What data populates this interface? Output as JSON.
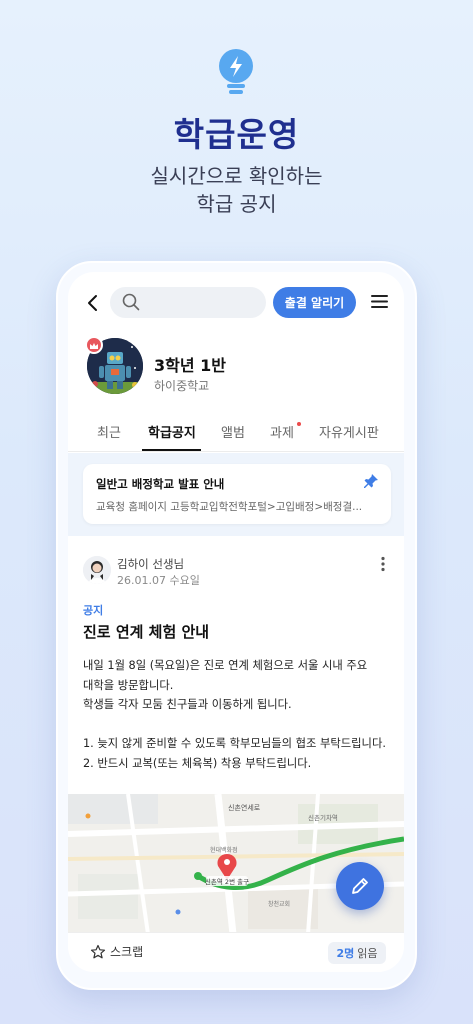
{
  "hero": {
    "title": "학급운영",
    "subtitle_line1": "실시간으로 확인하는",
    "subtitle_line2": "학급 공지"
  },
  "topbar": {
    "search_placeholder": "",
    "notice_button": "출결 알리기"
  },
  "class_header": {
    "class_name": "3학년 1반",
    "school_name": "하이중학교"
  },
  "tabs": [
    {
      "label": "최근",
      "active": false
    },
    {
      "label": "학급공지",
      "active": true
    },
    {
      "label": "앨범",
      "active": false
    },
    {
      "label": "과제",
      "active": false,
      "has_dot": true
    },
    {
      "label": "자유게시판",
      "active": false
    }
  ],
  "pinned": {
    "title": "일반고 배정학교 발표 안내",
    "description": "교육청 홈페이지 고등학교입학전학포털>고입배정>배정결..."
  },
  "post": {
    "author": "김하이 선생님",
    "date": "26.01.07 수요일",
    "category": "공지",
    "title": "진로 연계 체험 안내",
    "body_lines": [
      "내일 1월 8일 (목요일)은 진로 연계 체험으로 서울 시내 주요",
      "대학을 방문합니다.",
      "학생들 각자 모둠 친구들과 이동하게 됩니다.",
      "",
      "1.  늦지 않게 준비할 수 있도록 학부모님들의 협조 부탁드립니다.",
      "2. 반드시 교복(또는 체육복) 착용 부탁드립니다."
    ]
  },
  "map": {
    "labels": [
      "신촌연세로",
      "신촌기차역",
      "신촌역 2번 출구",
      "현대백화점",
      "창천교회"
    ]
  },
  "footer": {
    "scrap_label": "스크랩",
    "read_count": "2명",
    "read_label": "읽음"
  },
  "colors": {
    "accent": "#3f7de6",
    "title_navy": "#1f2f8f",
    "fab": "#3f73e0",
    "map_route": "#34b24a",
    "map_pin": "#e8484a"
  }
}
